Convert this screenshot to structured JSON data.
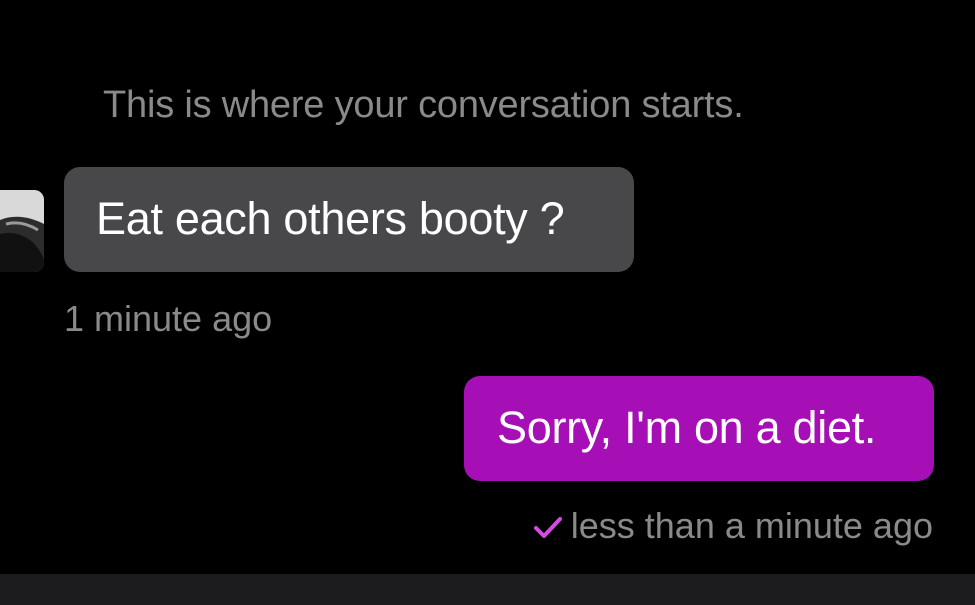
{
  "conversation": {
    "start_notice": "This is where your conversation starts."
  },
  "messages": {
    "incoming": {
      "text": "Eat each others booty ?",
      "timestamp": "1 minute ago",
      "bubble_color": "#48484a"
    },
    "outgoing": {
      "text": "Sorry, I'm on a diet.",
      "timestamp": "less than a minute ago",
      "status_icon": "checkmark-icon",
      "bubble_color": "#a50fb5",
      "check_color": "#d44be0"
    }
  }
}
